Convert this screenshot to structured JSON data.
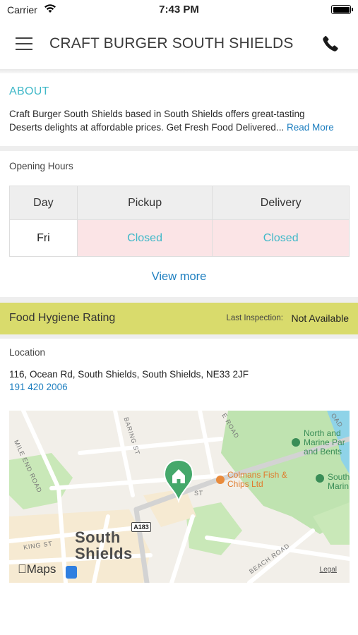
{
  "status_bar": {
    "carrier": "Carrier",
    "time": "7:43 PM"
  },
  "header": {
    "title": "CRAFT BURGER SOUTH SHIELDS",
    "menu_icon": "hamburger-menu-icon",
    "phone_icon": "phone-icon"
  },
  "about": {
    "title": "ABOUT",
    "line1": "Craft Burger South Shields based in South Shields offers great-tasting",
    "line2": "Deserts delights at affordable prices. Get Fresh Food Delivered",
    "ellipsis": "... ",
    "read_more": "Read More"
  },
  "opening_hours": {
    "heading": "Opening Hours",
    "columns": [
      "Day",
      "Pickup",
      "Delivery"
    ],
    "rows": [
      {
        "day": "Fri",
        "pickup": "Closed",
        "delivery": "Closed"
      }
    ],
    "view_more": "View more"
  },
  "hygiene": {
    "title": "Food Hygiene Rating",
    "inspection_label": "Last Inspection:",
    "inspection_value": "Not Available"
  },
  "location": {
    "heading": "Location",
    "address": "116, Ocean Rd, South Shields, South Shields, NE33 2JF",
    "phone": "191 420 2006"
  },
  "map": {
    "city_line1": "South",
    "city_line2": "Shields",
    "poi_line1": "Colmans Fish &",
    "poi_line2": "Chips Ltd",
    "park1_line1": "North and",
    "park1_line2": "Marine Par",
    "park1_line3": "and Bents",
    "park2_line1": "South",
    "park2_line2": "Marin",
    "road_badge": "A183",
    "roads": {
      "mile_end": "MILE END ROAD",
      "baring": "BARING ST",
      "ocean_e": "E ROAD",
      "king": "KING ST",
      "st": "ST",
      "beach": "BEACH ROAD",
      "oad": "OAD"
    },
    "logo": "Maps",
    "legal": "Legal",
    "colors": {
      "park": "#bfe3b0",
      "water": "#8fd3e8",
      "road": "#ffffff",
      "highlight_road": "#d8d8d8",
      "pin": "#45a86b"
    }
  }
}
